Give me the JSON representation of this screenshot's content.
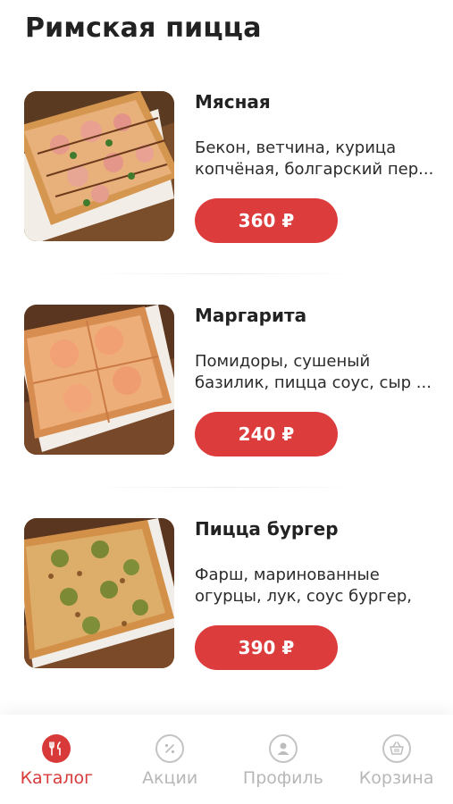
{
  "page": {
    "title": "Римская пицца"
  },
  "products": [
    {
      "name": "Мясная",
      "description": "Бекон, ветчина, курица копчёная, болгарский пер...",
      "price": "360 ₽",
      "image_icon": "meat-pizza-photo"
    },
    {
      "name": "Маргарита",
      "description": "Помидоры, сушеный базилик, пицца соус, сыр ...",
      "price": "240 ₽",
      "image_icon": "margherita-pizza-photo"
    },
    {
      "name": "Пицца бургер",
      "description": "Фарш, маринованные огурцы, лук, соус бургер, с...",
      "price": "390 ₽",
      "image_icon": "burger-pizza-photo"
    }
  ],
  "bottom_nav": {
    "items": [
      {
        "label": "Каталог",
        "icon": "catalog-icon",
        "active": true
      },
      {
        "label": "Акции",
        "icon": "discount-icon",
        "active": false
      },
      {
        "label": "Профиль",
        "icon": "profile-icon",
        "active": false
      },
      {
        "label": "Корзина",
        "icon": "basket-icon",
        "active": false
      }
    ]
  },
  "colors": {
    "accent": "#dc3c3c",
    "nav_inactive": "#b7b7b7",
    "title_text": "#222222"
  }
}
